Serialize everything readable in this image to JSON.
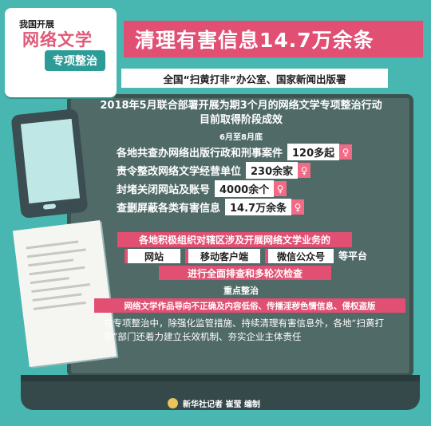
{
  "badge": {
    "line1": "我国开展",
    "line2": "网络文学",
    "line3": "专项整治"
  },
  "title": "清理有害信息14.7万余条",
  "source": "全国“扫黄打非”办公室、国家新闻出版署",
  "headline": {
    "line1": "2018年5月联合部署开展为期3个月的网络文学专项整治行动",
    "line2": "目前取得阶段成效"
  },
  "period": "6月至8月底",
  "stats": [
    {
      "label": "各地共查办网络出版行政和刑事案件",
      "value": "120多起"
    },
    {
      "label": "责令整改网络文学经营单位",
      "value": "230余家"
    },
    {
      "label": "封堵关闭网站及账号",
      "value": "4000余个"
    },
    {
      "label": "查删屏蔽各类有害信息",
      "value": "14.7万余条"
    }
  ],
  "pin_glyph": "♀",
  "organize": "各地积极组织对辖区涉及开展网络文学业务的",
  "platforms": [
    "网站",
    "移动客户端",
    "微信公众号"
  ],
  "platform_suffix": "等平台",
  "inspection": "进行全面排查和多轮次检查",
  "key_label": "重点整治",
  "key_items": "网络文学作品导向不正确及内容低俗、传播淫秽色情信息、侵权盗版",
  "body": "在专项整治中，除强化监管措施、持续清理有害信息外，各地“扫黄打非”部门还着力建立长效机制、夯实企业主体责任",
  "footer": "新华社记者 崔莹 编制",
  "colors": {
    "background": "#48b7b1",
    "accent": "#e14f73",
    "screen": "#4f6a67"
  }
}
